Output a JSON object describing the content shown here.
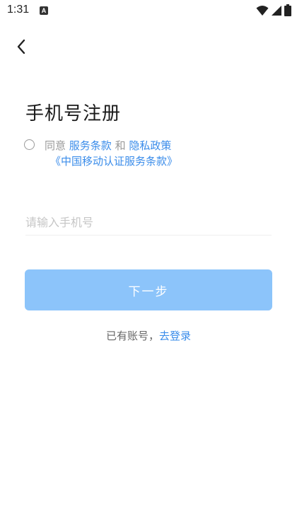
{
  "status_bar": {
    "time": "1:31",
    "app_icon_letter": "A",
    "icons": [
      "wifi-icon",
      "signal-icon",
      "battery-icon"
    ]
  },
  "header": {
    "back_icon": "chevron-left-icon"
  },
  "page": {
    "title": "手机号注册"
  },
  "agreement": {
    "checked": false,
    "agree_label": "同意",
    "terms_link": "服务条款",
    "and_label": "和",
    "privacy_link": "隐私政策",
    "carrier_terms_link": "《中国移动认证服务条款》"
  },
  "phone_input": {
    "placeholder": "请输入手机号",
    "value": ""
  },
  "next_button": {
    "label": "下一步"
  },
  "login_hint": {
    "text": "已有账号，",
    "link": "去登录"
  },
  "colors": {
    "link": "#3a8cea",
    "button_bg": "#8cc4fa",
    "muted_text": "#999999",
    "placeholder": "#c6c6c6"
  }
}
